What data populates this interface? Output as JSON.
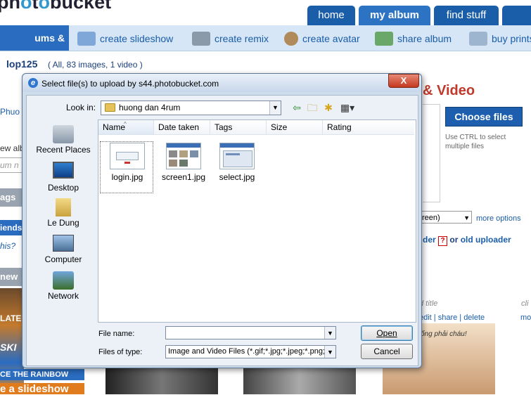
{
  "site": {
    "logo": "photobucket",
    "nav_tabs": [
      "home",
      "my album",
      "find stuff"
    ],
    "subnav": {
      "active": "ums & upload",
      "items": [
        "create slideshow",
        "create remix",
        "create avatar",
        "share album",
        "buy prints"
      ]
    },
    "user": {
      "name": "lop125",
      "info": "( All, 83 images, 1 video )"
    },
    "left_fragments": {
      "phuo": "Phuo",
      "new_alb": "ew alb",
      "um_n": "um n",
      "tags": "ags",
      "friends": "iends",
      "this": "his?",
      "new": "new",
      "late": "LATE",
      "ski": "SKI",
      "rainbow": "CE THE RAINBOW",
      "slideshow": "e a slideshow"
    },
    "upload_panel": {
      "title_fragment": "& Video",
      "choose_files": "Choose files",
      "hint": "Use CTRL to select multiple files",
      "size_value": "reen)",
      "more_options": "more options",
      "uploader_prefix": "der",
      "help_mark": "?",
      "or": "or",
      "old_uploader": "old uploader"
    },
    "thumbs": {
      "title": "d title",
      "title2": "cli",
      "actions": "edit | share | delete",
      "actions2": "mov",
      "caption": "ống phải cháu!"
    }
  },
  "dialog": {
    "title": "Select file(s) to upload by s44.photobucket.com",
    "close_glyph": "X",
    "look_in_label": "Look in:",
    "look_in_value": "huong dan 4rum",
    "places": [
      "Recent Places",
      "Desktop",
      "Le Dung",
      "Computer",
      "Network"
    ],
    "columns": [
      "Name",
      "Date taken",
      "Tags",
      "Size",
      "Rating"
    ],
    "files": [
      {
        "name": "login.jpg",
        "selected": true
      },
      {
        "name": "screen1.jpg",
        "selected": false
      },
      {
        "name": "select.jpg",
        "selected": false
      }
    ],
    "file_name_label": "File name:",
    "file_name_value": "",
    "files_of_type_label": "Files of type:",
    "files_of_type_value": "Image and Video Files (*.gif;*.jpg;*.jpeg;*.png;*.b",
    "open_button": "Open",
    "cancel_button": "Cancel"
  },
  "colors": {
    "nav_blue": "#1a5da8",
    "subnav_bg": "#d6e6f6",
    "dialog_frame": "#cfdcec",
    "accent_red": "#c0392b"
  }
}
